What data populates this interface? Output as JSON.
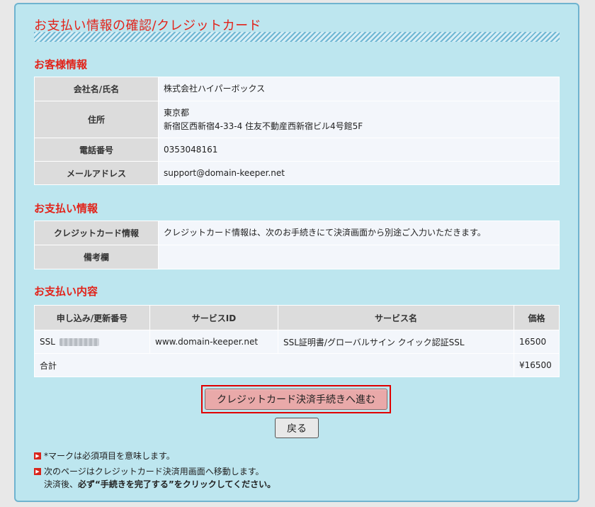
{
  "page": {
    "title": "お支払い情報の確認/クレジットカード"
  },
  "customer": {
    "heading": "お客様情報",
    "rows": [
      {
        "label": "会社名/氏名",
        "value": "株式会社ハイパーボックス"
      },
      {
        "label": "住所",
        "value_line1": "東京都",
        "value_line2": "新宿区西新宿4-33-4 住友不動産西新宿ビル4号館5F"
      },
      {
        "label": "電話番号",
        "value": "0353048161"
      },
      {
        "label": "メールアドレス",
        "value": "support@domain-keeper.net"
      }
    ]
  },
  "payment_info": {
    "heading": "お支払い情報",
    "rows": [
      {
        "label": "クレジットカード情報",
        "value": "クレジットカード情報は、次のお手続きにて決済画面から別途ご入力いただきます。"
      },
      {
        "label": "備考欄",
        "value": ""
      }
    ]
  },
  "payment_details": {
    "heading": "お支払い内容",
    "columns": [
      "申し込み/更新番号",
      "サービスID",
      "サービス名",
      "価格"
    ],
    "rows": [
      {
        "number_prefix": "SSL",
        "service_id": "www.domain-keeper.net",
        "service_name": "SSL証明書/グローバルサイン クイック認証SSL",
        "price": "16500"
      }
    ],
    "total_label": "合計",
    "total_value": "¥16500"
  },
  "buttons": {
    "proceed": "クレジットカード決済手続きへ進む",
    "back": "戻る"
  },
  "notes": {
    "note1": "*マークは必須項目を意味します。",
    "note2_line1": "次のページはクレジットカード決済用画面へ移動します。",
    "note2_line2_prefix": "決済後、",
    "note2_line2_bold": "必ず“手続きを完了する”をクリックしてください。"
  },
  "colors": {
    "accent_red": "#e2231a",
    "panel_bg": "#bde6ef",
    "button_proceed": "#e9a9a9"
  }
}
